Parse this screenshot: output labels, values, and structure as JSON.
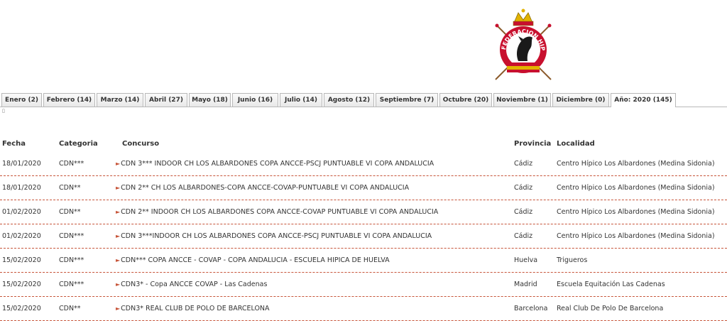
{
  "tabs": [
    {
      "label": "Enero (2)",
      "active": false
    },
    {
      "label": "Febrero (14)",
      "active": false
    },
    {
      "label": "Marzo (14)",
      "active": false
    },
    {
      "label": "Abril (27)",
      "active": false
    },
    {
      "label": "Mayo (18)",
      "active": false
    },
    {
      "label": "Junio (16)",
      "active": false
    },
    {
      "label": "Julio (14)",
      "active": false
    },
    {
      "label": "Agosto (12)",
      "active": false
    },
    {
      "label": "Septiembre (7)",
      "active": false
    },
    {
      "label": "Octubre (20)",
      "active": false
    },
    {
      "label": "Noviembre (1)",
      "active": false
    },
    {
      "label": "Diciembre (0)",
      "active": false
    },
    {
      "label": "Año: 2020 (145)",
      "active": true
    }
  ],
  "marker": "▯",
  "table": {
    "headers": {
      "fecha": "Fecha",
      "categoria": "Categoria",
      "concurso": "Concurso",
      "provincia": "Provincia",
      "localidad": "Localidad"
    },
    "rows": [
      {
        "fecha": "18/01/2020",
        "categoria": "CDN***",
        "concurso": "CDN 3*** INDOOR CH LOS ALBARDONES COPA ANCCE-PSCJ PUNTUABLE VI COPA ANDALUCIA",
        "provincia": "Cádiz",
        "localidad": "Centro Hípico Los Albardones (Medina Sidonia)"
      },
      {
        "fecha": "18/01/2020",
        "categoria": "CDN**",
        "concurso": "CDN 2** CH LOS ALBARDONES-COPA ANCCE-COVAP-PUNTUABLE VI COPA ANDALUCIA",
        "provincia": "Cádiz",
        "localidad": "Centro Hípico Los Albardones (Medina Sidonia)"
      },
      {
        "fecha": "01/02/2020",
        "categoria": "CDN**",
        "concurso": "CDN 2** INDOOR CH LOS ALBARDONES COPA ANCCE-COVAP PUNTUABLE VI COPA ANDALUCIA",
        "provincia": "Cádiz",
        "localidad": "Centro Hípico Los Albardones (Medina Sidonia)"
      },
      {
        "fecha": "01/02/2020",
        "categoria": "CDN***",
        "concurso": "CDN 3***INDOOR CH LOS ALBARDONES COPA ANCCE-PSCJ PUNTUABLE VI COPA ANDALUCIA",
        "provincia": "Cádiz",
        "localidad": "Centro Hípico Los Albardones (Medina Sidonia)"
      },
      {
        "fecha": "15/02/2020",
        "categoria": "CDN***",
        "concurso": "CDN*** COPA ANCCE - COVAP - COPA ANDALUCIA - ESCUELA HIPICA DE HUELVA",
        "provincia": "Huelva",
        "localidad": "Trigueros"
      },
      {
        "fecha": "15/02/2020",
        "categoria": "CDN***",
        "concurso": "CDN3* - Copa ANCCE COVAP - Las Cadenas",
        "provincia": "Madrid",
        "localidad": "Escuela Equitación Las Cadenas"
      },
      {
        "fecha": "15/02/2020",
        "categoria": "CDN**",
        "concurso": "CDN3* REAL CLUB DE POLO DE BARCELONA",
        "provincia": "Barcelona",
        "localidad": "Real Club De Polo De Barcelona"
      }
    ]
  },
  "logo": {
    "text": "FEDERACION HIPICA ESPAÑOLA",
    "colors": {
      "red": "#c8102e",
      "gold": "#e2b300",
      "dark": "#1a1a1a",
      "blue": "#1c3f94"
    }
  }
}
